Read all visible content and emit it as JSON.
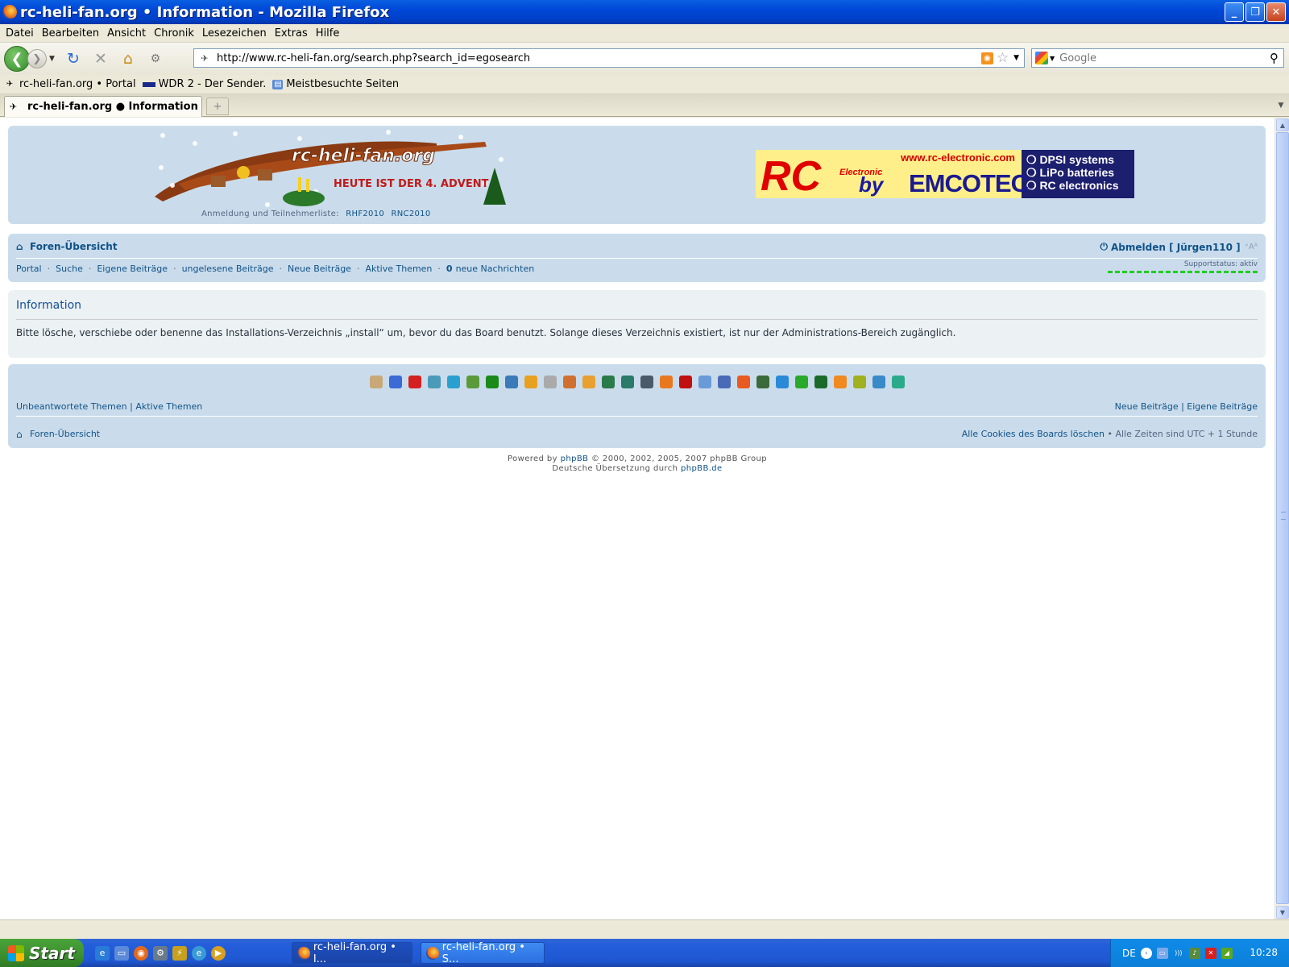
{
  "window": {
    "title": "rc-heli-fan.org • Information - Mozilla Firefox",
    "buttons": [
      "_",
      "❐",
      "✕"
    ]
  },
  "menu": [
    "Datei",
    "Bearbeiten",
    "Ansicht",
    "Chronik",
    "Lesezeichen",
    "Extras",
    "Hilfe"
  ],
  "navbar": {
    "url": "http://www.rc-heli-fan.org/search.php?search_id=egosearch",
    "search_placeholder": "Google",
    "icons": [
      "back-icon",
      "forward-icon",
      "reload-icon",
      "stop-icon",
      "home-icon",
      "addon-icon"
    ]
  },
  "bookmarks": [
    {
      "label": "rc-heli-fan.org • Portal",
      "icon": "heli-icon"
    },
    {
      "label": "WDR 2 - Der Sender.",
      "icon": "flag-icon"
    },
    {
      "label": "Meistbesuchte Seiten",
      "icon": "bookmark-folder-icon"
    }
  ],
  "tabs": [
    {
      "label": "rc-heli-fan.org ● Information"
    }
  ],
  "header": {
    "logo_text": "rc-heli-fan.org",
    "logo_caption": "HEUTE IST DER 4. ADVENT",
    "logo_sub_label": "Anmeldung und Teilnehmerliste:",
    "logo_sub_links": [
      "RHF2010",
      "RNC2010"
    ],
    "ad": {
      "site": "www.rc-electronic.com",
      "rc": "RC",
      "electronic": "Electronic",
      "by": "by",
      "brand": "EMCOTEC",
      "bullets": [
        "❍ DPSI systems",
        "❍ LiPo batteries",
        "❍ RC electronics"
      ]
    }
  },
  "nav": {
    "home": "Foren-Übersicht",
    "logout": "Abmelden [ Jürgen110 ]",
    "fontsize": "ᵛAᴬ",
    "links": [
      "Portal",
      "Suche",
      "Eigene Beiträge",
      "ungelesene Beiträge",
      "Neue Beiträge",
      "Aktive Themen"
    ],
    "pm_count": "0",
    "pm_label": "neue Nachrichten",
    "support": "Supportstatus: aktiv"
  },
  "info": {
    "title": "Information",
    "message": "Bitte lösche, verschiebe oder benenne das Installations-Verzeichnis „install“ um, bevor du das Board benutzt. Solange dieses Verzeichnis existiert, ist nur der Administrations-Bereich zugänglich."
  },
  "footer": {
    "left_links": "Unbeantwortete Themen | Aktive Themen",
    "right_links": "Neue Beiträge | Eigene Beiträge",
    "home": "Foren-Übersicht",
    "cookies": "Alle Cookies des Boards löschen",
    "timezone": " • Alle Zeiten sind UTC + 1 Stunde",
    "powered_prefix": "Powered by",
    "powered_link": "phpBB",
    "powered_suffix": "© 2000, 2002, 2005, 2007 phpBB Group",
    "translation_prefix": "Deutsche Übersetzung durch",
    "translation_link": "phpBB.de"
  },
  "social_icons": [
    {
      "name": "mister-wong-icon",
      "color": "#c8a878"
    },
    {
      "name": "delicious-icon",
      "color": "#3a6ad6"
    },
    {
      "name": "mrwong-w-icon",
      "color": "#d42020"
    },
    {
      "name": "icio-icon",
      "color": "#4a9ab8"
    },
    {
      "name": "yigg-icon",
      "color": "#2aa0d0"
    },
    {
      "name": "linkarena-icon",
      "color": "#5a9a3a"
    },
    {
      "name": "oneview-icon",
      "color": "#1a8a1a"
    },
    {
      "name": "folkd-icon",
      "color": "#3a7ab8"
    },
    {
      "name": "yahoo-star-icon",
      "color": "#e8a020"
    },
    {
      "name": "webnews-icon",
      "color": "#aaaaaa"
    },
    {
      "name": "seoigg-icon",
      "color": "#d07030"
    },
    {
      "name": "netscape-icon",
      "color": "#e8a030"
    },
    {
      "name": "stumbleupon-icon",
      "color": "#2a7a4a"
    },
    {
      "name": "slashdot-icon",
      "color": "#2a7a6a"
    },
    {
      "name": "newsvine-icon",
      "color": "#4a5a6a"
    },
    {
      "name": "furl-icon",
      "color": "#e87820"
    },
    {
      "name": "yahoo-y-icon",
      "color": "#c01010"
    },
    {
      "name": "spurl-icon",
      "color": "#6a9ad8"
    },
    {
      "name": "google-icon",
      "color": "#4a6ab8"
    },
    {
      "name": "reddit-icon",
      "color": "#e85a20"
    },
    {
      "name": "play-icon",
      "color": "#3a6a3a"
    },
    {
      "name": "hh-icon",
      "color": "#2a8ad8"
    },
    {
      "name": "linkedin-icon",
      "color": "#2aaa2a"
    },
    {
      "name": "tree-icon",
      "color": "#1a6a2a"
    },
    {
      "name": "blogger-icon",
      "color": "#f08a20"
    },
    {
      "name": "gear-icon",
      "color": "#a0b020"
    },
    {
      "name": "robot-icon",
      "color": "#3a8ac8"
    },
    {
      "name": "n-icon",
      "color": "#2aaa8a"
    }
  ],
  "taskbar": {
    "start": "Start",
    "windows": [
      "rc-heli-fan.org • I...",
      "rc-heli-fan.org • S..."
    ],
    "lang": "DE",
    "clock": "10:28"
  }
}
